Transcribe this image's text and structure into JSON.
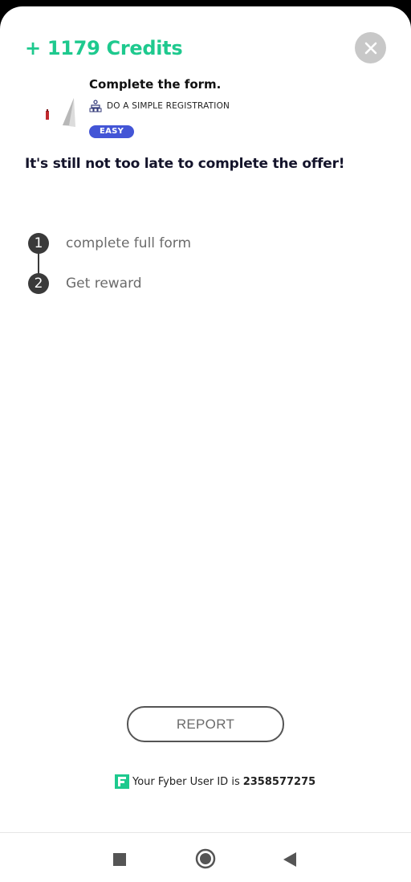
{
  "offer": {
    "credits": "+ 1179 Credits",
    "title": "Complete the form.",
    "task_label": "DO A SIMPLE REGISTRATION",
    "difficulty": "EASY",
    "headline": "It's still not too late to complete the offer!"
  },
  "steps": [
    {
      "number": "1",
      "label": "complete full form"
    },
    {
      "number": "2",
      "label": "Get reward"
    }
  ],
  "footer": {
    "report_label": "REPORT",
    "userid_prefix": "Your Fyber User ID is",
    "userid_value": "2358577275"
  },
  "icons": {
    "close": "close-icon",
    "offer_thumb": "offer-image",
    "task": "registration-icon",
    "fyber": "fyber-logo-icon",
    "nav_recents": "recents-square-icon",
    "nav_home": "home-circle-icon",
    "nav_back": "back-triangle-icon"
  },
  "colors": {
    "accent_green": "#1ec98e",
    "badge_blue": "#4355d6",
    "close_gray": "#c8c8c8",
    "step_dark": "#3a3a3a"
  }
}
